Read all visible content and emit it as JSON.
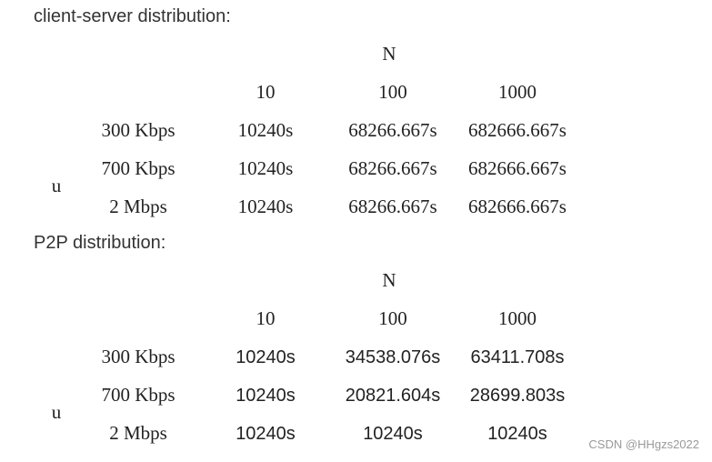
{
  "client_server": {
    "heading": "client-server distribution:",
    "n_label": "N",
    "u_label": "u",
    "n_values": [
      "10",
      "100",
      "1000"
    ],
    "rows": [
      {
        "u": "300 Kbps",
        "times": [
          "10240s",
          "68266.667s",
          "682666.667s"
        ]
      },
      {
        "u": "700 Kbps",
        "times": [
          "10240s",
          "68266.667s",
          "682666.667s"
        ]
      },
      {
        "u": "2 Mbps",
        "times": [
          "10240s",
          "68266.667s",
          "682666.667s"
        ]
      }
    ]
  },
  "p2p": {
    "heading": "P2P distribution:",
    "n_label": "N",
    "u_label": "u",
    "n_values": [
      "10",
      "100",
      "1000"
    ],
    "rows": [
      {
        "u": "300 Kbps",
        "times": [
          "10240s",
          "34538.076s",
          "63411.708s"
        ]
      },
      {
        "u": "700 Kbps",
        "times": [
          "10240s",
          "20821.604s",
          "28699.803s"
        ]
      },
      {
        "u": "2 Mbps",
        "times": [
          "10240s",
          "10240s",
          "10240s"
        ]
      }
    ]
  },
  "watermark": "CSDN @HHgzs2022"
}
